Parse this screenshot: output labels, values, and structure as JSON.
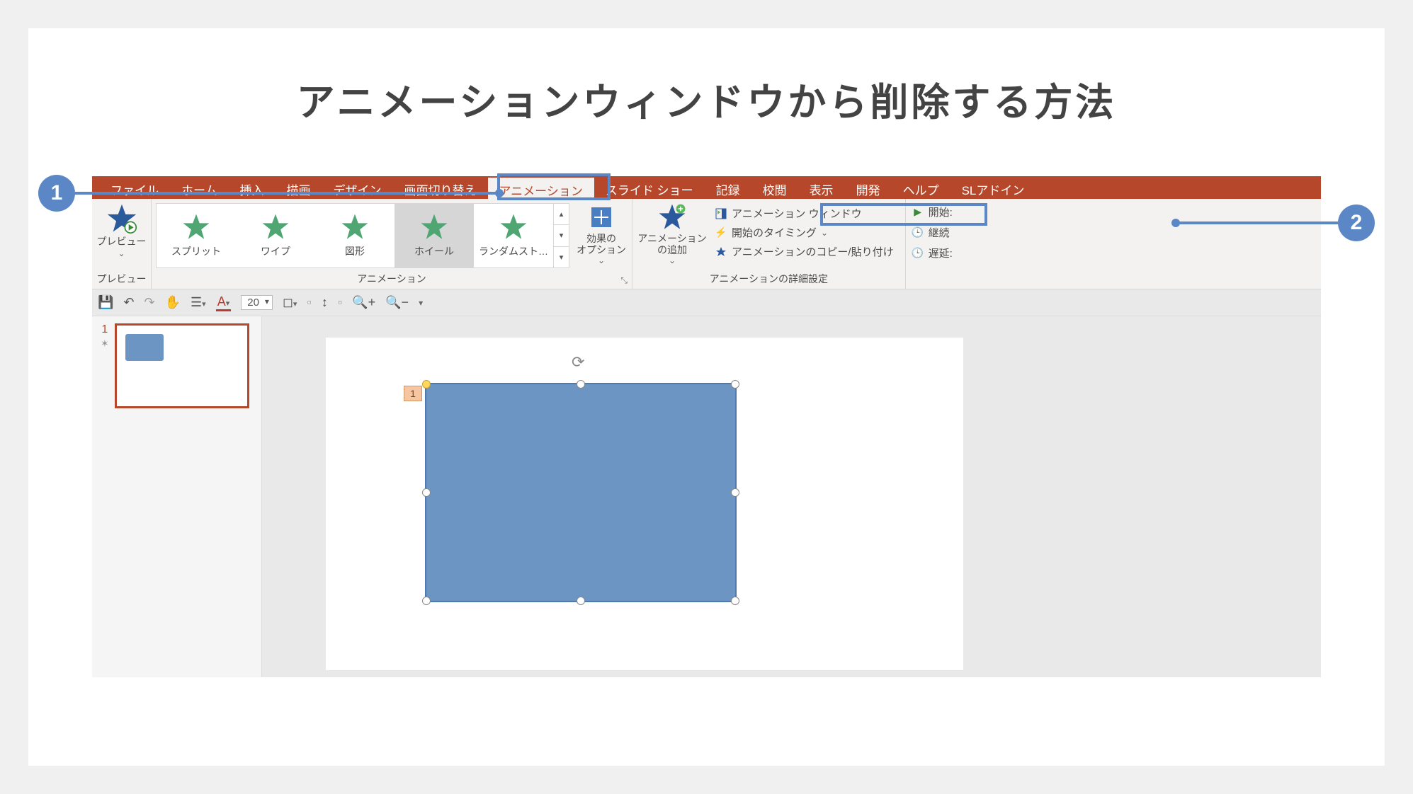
{
  "title": "アニメーションウィンドウから削除する方法",
  "callouts": {
    "c1": "1",
    "c2": "2"
  },
  "ribbon": {
    "tabs": [
      "ファイル",
      "ホーム",
      "挿入",
      "描画",
      "デザイン",
      "画面切り替え",
      "アニメーション",
      "スライド ショー",
      "記録",
      "校閲",
      "表示",
      "開発",
      "ヘルプ",
      "SLアドイン"
    ],
    "active_tab": "アニメーション",
    "groups": {
      "preview": {
        "label": "プレビュー",
        "button": "プレビュー"
      },
      "animation": {
        "label": "アニメーション",
        "items": [
          "スプリット",
          "ワイプ",
          "図形",
          "ホイール",
          "ランダムスト…"
        ],
        "selected": "ホイール",
        "effect_options": "効果の\nオプション"
      },
      "advanced": {
        "label": "アニメーションの詳細設定",
        "add": "アニメーション\nの追加",
        "pane": "アニメーション ウィンドウ",
        "trigger": "開始のタイミング",
        "painter": "アニメーションのコピー/貼り付け"
      },
      "timing": {
        "start": "開始:",
        "duration": "継続",
        "delay": "遅延:"
      }
    }
  },
  "qat": {
    "font_size": "20"
  },
  "editor": {
    "slide_number": "1",
    "anim_tag": "1"
  },
  "colors": {
    "brand": "#b7472a",
    "accent": "#5b87c6",
    "shape": "#6d95c3"
  }
}
